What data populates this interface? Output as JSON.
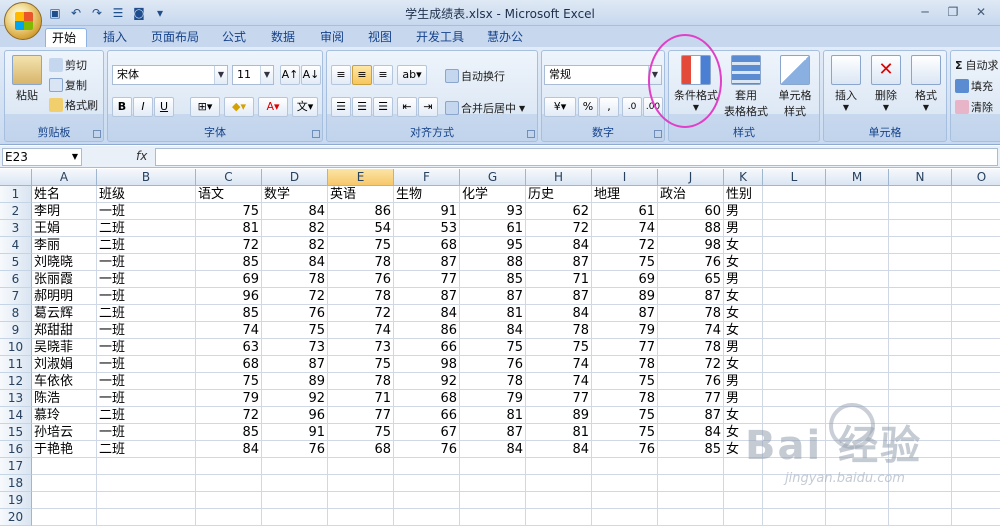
{
  "window": {
    "title": "学生成绩表.xlsx - Microsoft Excel",
    "qat": [
      "save-icon",
      "undo-icon",
      "redo-icon",
      "custom-icon",
      "camera-icon"
    ]
  },
  "tabs": [
    "开始",
    "插入",
    "页面布局",
    "公式",
    "数据",
    "审阅",
    "视图",
    "开发工具",
    "慧办公"
  ],
  "ribbon": {
    "clipboard": {
      "paste": "粘贴",
      "cut": "剪切",
      "copy": "复制",
      "format_painter": "格式刷",
      "label": "剪贴板"
    },
    "font": {
      "name": "宋体",
      "size": "11",
      "bold": "B",
      "italic": "I",
      "underline": "U",
      "label": "字体"
    },
    "alignment": {
      "wrap": "自动换行",
      "merge": "合并后居中",
      "label": "对齐方式"
    },
    "number": {
      "format": "常规",
      "percent": "%",
      "comma": ",",
      "label": "数字"
    },
    "styles": {
      "conditional": "条件格式",
      "table_top": "套用",
      "table_bottom": "表格格式",
      "cell_top": "单元格",
      "cell_bottom": "样式",
      "label": "样式"
    },
    "cells": {
      "insert": "插入",
      "delete": "删除",
      "format": "格式",
      "label": "单元格"
    },
    "editing": {
      "autosum": "自动求",
      "fill": "填充",
      "clear": "清除"
    }
  },
  "formula_bar": {
    "name_box": "E23",
    "fx": "fx",
    "content": ""
  },
  "sheet": {
    "columns": [
      "A",
      "B",
      "C",
      "D",
      "E",
      "F",
      "G",
      "H",
      "I",
      "J",
      "K",
      "L",
      "M",
      "N",
      "O"
    ],
    "selected_column": "E",
    "row_numbers": [
      "1",
      "2",
      "3",
      "4",
      "5",
      "6",
      "7",
      "8",
      "9",
      "10",
      "11",
      "12",
      "13",
      "14",
      "15",
      "16",
      "17",
      "18",
      "19",
      "20"
    ],
    "header": [
      "姓名",
      "班级",
      "语文",
      "数学",
      "英语",
      "生物",
      "化学",
      "历史",
      "地理",
      "政治",
      "性别"
    ],
    "rows": [
      [
        "李明",
        "一班",
        "75",
        "84",
        "86",
        "91",
        "93",
        "62",
        "61",
        "60",
        "男"
      ],
      [
        "王娟",
        "二班",
        "81",
        "82",
        "54",
        "53",
        "61",
        "72",
        "74",
        "88",
        "男"
      ],
      [
        "李丽",
        "二班",
        "72",
        "82",
        "75",
        "68",
        "95",
        "84",
        "72",
        "98",
        "女"
      ],
      [
        "刘晓晓",
        "一班",
        "85",
        "84",
        "78",
        "87",
        "88",
        "87",
        "75",
        "76",
        "女"
      ],
      [
        "张丽霞",
        "一班",
        "69",
        "78",
        "76",
        "77",
        "85",
        "71",
        "69",
        "65",
        "男"
      ],
      [
        "郝明明",
        "一班",
        "96",
        "72",
        "78",
        "87",
        "87",
        "87",
        "89",
        "87",
        "女"
      ],
      [
        "葛云辉",
        "二班",
        "85",
        "76",
        "72",
        "84",
        "81",
        "84",
        "87",
        "78",
        "女"
      ],
      [
        "郑甜甜",
        "一班",
        "74",
        "75",
        "74",
        "86",
        "84",
        "78",
        "79",
        "74",
        "女"
      ],
      [
        "吴晓菲",
        "一班",
        "63",
        "73",
        "73",
        "66",
        "75",
        "75",
        "77",
        "78",
        "男"
      ],
      [
        "刘淑娟",
        "一班",
        "68",
        "87",
        "75",
        "98",
        "76",
        "74",
        "78",
        "72",
        "女"
      ],
      [
        "车依依",
        "一班",
        "75",
        "89",
        "78",
        "92",
        "78",
        "74",
        "75",
        "76",
        "男"
      ],
      [
        "陈浩",
        "一班",
        "79",
        "92",
        "71",
        "68",
        "79",
        "77",
        "78",
        "77",
        "男"
      ],
      [
        "慕玲",
        "二班",
        "72",
        "96",
        "77",
        "66",
        "81",
        "89",
        "75",
        "87",
        "女"
      ],
      [
        "孙培云",
        "一班",
        "85",
        "91",
        "75",
        "67",
        "87",
        "81",
        "75",
        "84",
        "女"
      ],
      [
        "于艳艳",
        "二班",
        "84",
        "76",
        "68",
        "76",
        "84",
        "84",
        "76",
        "85",
        "女"
      ]
    ]
  },
  "watermark": {
    "brand": "Bai 经验",
    "url": "jingyan.baidu.com"
  }
}
